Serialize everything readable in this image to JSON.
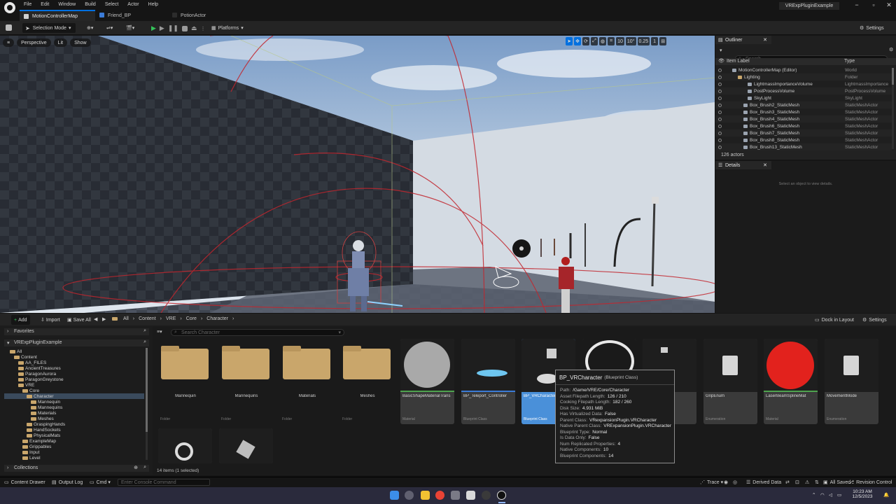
{
  "window": {
    "app_title": "VRExpPluginExample",
    "menu": [
      "File",
      "Edit",
      "Window",
      "Build",
      "Select",
      "Actor",
      "Help"
    ],
    "tabs": [
      {
        "label": "MotionControllerMap",
        "active": true
      },
      {
        "label": "Friend_BP",
        "active": false
      },
      {
        "label": "PotionActor",
        "active": false
      }
    ],
    "controls": {
      "minimize": "−",
      "maximize": "▫",
      "close": "✕"
    }
  },
  "toolbar": {
    "selection_mode": "Selection Mode",
    "platforms": "Platforms",
    "settings": "Settings"
  },
  "viewport": {
    "perspective": "Perspective",
    "lit": "Lit",
    "show": "Show",
    "grid_snap": "10",
    "rotation_snap": "10°",
    "scale_snap": "0.25",
    "camera_speed": "1",
    "layer_count": "1"
  },
  "outliner": {
    "title": "Outliner",
    "search_placeholder": "Search",
    "col_label": "Item Label",
    "col_type": "Type",
    "rows": [
      {
        "label": "MotionControllerMap (Editor)",
        "type": "World",
        "indent": 24
      },
      {
        "label": "Lighting",
        "type": "Folder",
        "indent": 32
      },
      {
        "label": "LightmassImportanceVolume",
        "type": "LightmassImportance",
        "indent": 46
      },
      {
        "label": "PostProcessVolume",
        "type": "PostProcessVolume",
        "indent": 46
      },
      {
        "label": "SkyLight",
        "type": "SkyLight",
        "indent": 46
      },
      {
        "label": "Box_Brush2_StaticMesh",
        "type": "StaticMeshActor",
        "indent": 40
      },
      {
        "label": "Box_Brush3_StaticMesh",
        "type": "StaticMeshActor",
        "indent": 40
      },
      {
        "label": "Box_Brush4_StaticMesh",
        "type": "StaticMeshActor",
        "indent": 40
      },
      {
        "label": "Box_Brush6_StaticMesh",
        "type": "StaticMeshActor",
        "indent": 40
      },
      {
        "label": "Box_Brush7_StaticMesh",
        "type": "StaticMeshActor",
        "indent": 40
      },
      {
        "label": "Box_Brush8_StaticMesh",
        "type": "StaticMeshActor",
        "indent": 40
      },
      {
        "label": "Box_Brush13_StaticMesh",
        "type": "StaticMeshActor",
        "indent": 40
      }
    ],
    "actor_count": "126 actors"
  },
  "details": {
    "title": "Details",
    "empty_message": "Select an object to view details."
  },
  "content_browser": {
    "add": "Add",
    "import": "Import",
    "save_all": "Save All",
    "breadcrumb": [
      "All",
      "Content",
      "VRE",
      "Core",
      "Character"
    ],
    "dock_in_layout": "Dock in Layout",
    "settings": "Settings",
    "favorites": "Favorites",
    "project": "VRExpPluginExample",
    "search_placeholder": "Search Character",
    "tree": [
      {
        "label": "All",
        "indent": 8
      },
      {
        "label": "Content",
        "indent": 14
      },
      {
        "label": "AA_FILES",
        "indent": 20
      },
      {
        "label": "AncientTreasures",
        "indent": 20
      },
      {
        "label": "ParagonAurora",
        "indent": 20
      },
      {
        "label": "ParagonGreystone",
        "indent": 20
      },
      {
        "label": "VRE",
        "indent": 20
      },
      {
        "label": "Core",
        "indent": 26
      },
      {
        "label": "Character",
        "indent": 32,
        "selected": true
      },
      {
        "label": "Mannequin",
        "indent": 38
      },
      {
        "label": "Mannequins",
        "indent": 38
      },
      {
        "label": "Materials",
        "indent": 38
      },
      {
        "label": "Meshes",
        "indent": 38
      },
      {
        "label": "GraspingHands",
        "indent": 32
      },
      {
        "label": "HandSockets",
        "indent": 32
      },
      {
        "label": "PhysicalMats",
        "indent": 32
      },
      {
        "label": "ExampleMap",
        "indent": 26
      },
      {
        "label": "Grippables",
        "indent": 26
      },
      {
        "label": "Input",
        "indent": 26
      },
      {
        "label": "Level",
        "indent": 26
      }
    ],
    "collections": "Collections",
    "items": [
      {
        "label": "Mannequin",
        "kind": "Folder"
      },
      {
        "label": "Mannequins",
        "kind": "Folder"
      },
      {
        "label": "Materials",
        "kind": "Folder"
      },
      {
        "label": "Meshes",
        "kind": "Folder"
      },
      {
        "label": "BasicShapeMaterialTrans",
        "kind": "Material"
      },
      {
        "label": "BP_Teleport_Controller",
        "kind": "Blueprint Class"
      },
      {
        "label": "BP_VRCharacter",
        "kind": "Blueprint Class"
      },
      {
        "label": "",
        "kind": ""
      },
      {
        "label": "r",
        "kind": ""
      },
      {
        "label": "GripEnum",
        "kind": "Enumeration"
      },
      {
        "label": "LaserBeamSplineMat",
        "kind": "Material"
      },
      {
        "label": "MovementMode",
        "kind": "Enumeration"
      }
    ],
    "item_count": "14 items (1 selected)"
  },
  "tooltip": {
    "title": "BP_VRCharacter",
    "subtitle": "(Blueprint Class)",
    "lines": [
      {
        "k": "Path:",
        "v": "/Game/VRE/Core/Character"
      },
      {
        "k": "Asset Filepath Length:",
        "v": "126 / 210"
      },
      {
        "k": "Cooking Filepath Length:",
        "v": "182 / 260"
      },
      {
        "k": "Disk Size:",
        "v": "4.931 MiB"
      },
      {
        "k": "Has Virtualized Data:",
        "v": "False"
      },
      {
        "k": "Parent Class:",
        "v": "VRexpansionPlugin.VRCharacter"
      },
      {
        "k": "Native Parent Class:",
        "v": "VRExpansionPlugin.VRCharacter"
      },
      {
        "k": "Blueprint Type:",
        "v": "Normal"
      },
      {
        "k": "Is Data Only:",
        "v": "False"
      },
      {
        "k": "Num Replicated Properties:",
        "v": "4"
      },
      {
        "k": "Native Components:",
        "v": "10"
      },
      {
        "k": "Blueprint Components:",
        "v": "14"
      }
    ]
  },
  "status_bar": {
    "content_drawer": "Content Drawer",
    "output_log": "Output Log",
    "cmd": "Cmd",
    "console_placeholder": "Enter Console Command",
    "trace": "Trace",
    "derived_data": "Derived Data",
    "all_saved": "All Saved",
    "revision_control": "Revision Control"
  },
  "taskbar": {
    "time": "10:23 AM",
    "date": "12/5/2023"
  }
}
